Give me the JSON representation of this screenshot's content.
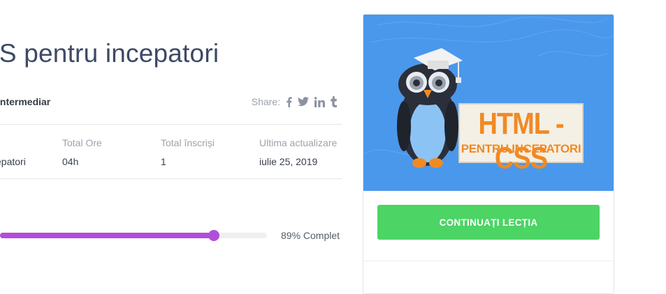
{
  "course": {
    "title": "SS pentru incepatori",
    "level": "Intermediar"
  },
  "share": {
    "label": "Share:",
    "icons": [
      "facebook-icon",
      "twitter-icon",
      "linkedin-icon",
      "tumblr-icon"
    ]
  },
  "meta": {
    "category_value": "epatori",
    "total_hours_label": "Total Ore",
    "total_hours_value": "04h",
    "enrolled_label": "Total înscriși",
    "enrolled_value": "1",
    "updated_label": "Ultima actualizare",
    "updated_value": "iulie 25, 2019"
  },
  "progress": {
    "percent": 80,
    "text": "89% Complet"
  },
  "sidebar": {
    "thumbnail_title": "HTML - CSS",
    "thumbnail_subtitle": "PENTRU INCEPATORI",
    "cta_label": "CONTINUAȚI LECȚIA"
  },
  "colors": {
    "accent_purple": "#b24fd8",
    "cta_green": "#4cd464",
    "thumb_blue": "#4a98ec",
    "thumb_orange": "#f08a24"
  }
}
